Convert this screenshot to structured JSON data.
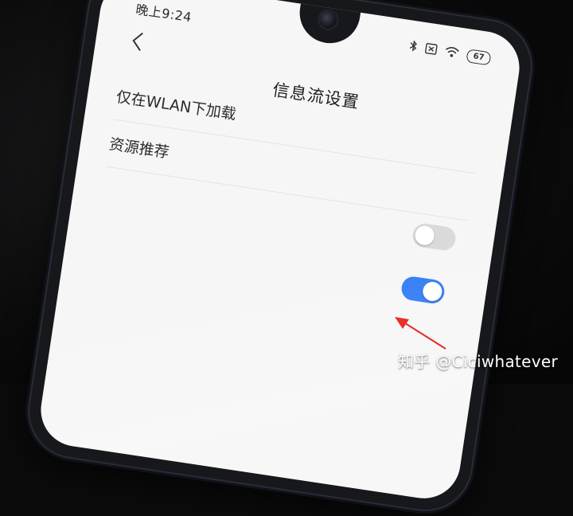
{
  "status_bar": {
    "time": "晚上9:24",
    "bluetooth_icon": "bluetooth-icon",
    "sim_icon": "no-sim-icon",
    "wifi_icon": "wifi-icon",
    "battery_level": "67"
  },
  "header": {
    "back_icon": "chevron-left-icon",
    "title": "信息流设置"
  },
  "settings": [
    {
      "label": "仅在WLAN下加载",
      "enabled": false
    },
    {
      "label": "资源推荐",
      "enabled": true
    }
  ],
  "colors": {
    "toggle_on": "#2f7af5",
    "toggle_off": "#dadada",
    "annotation_arrow": "#e8302a"
  },
  "watermark": "知乎 @Ciciwhatever"
}
